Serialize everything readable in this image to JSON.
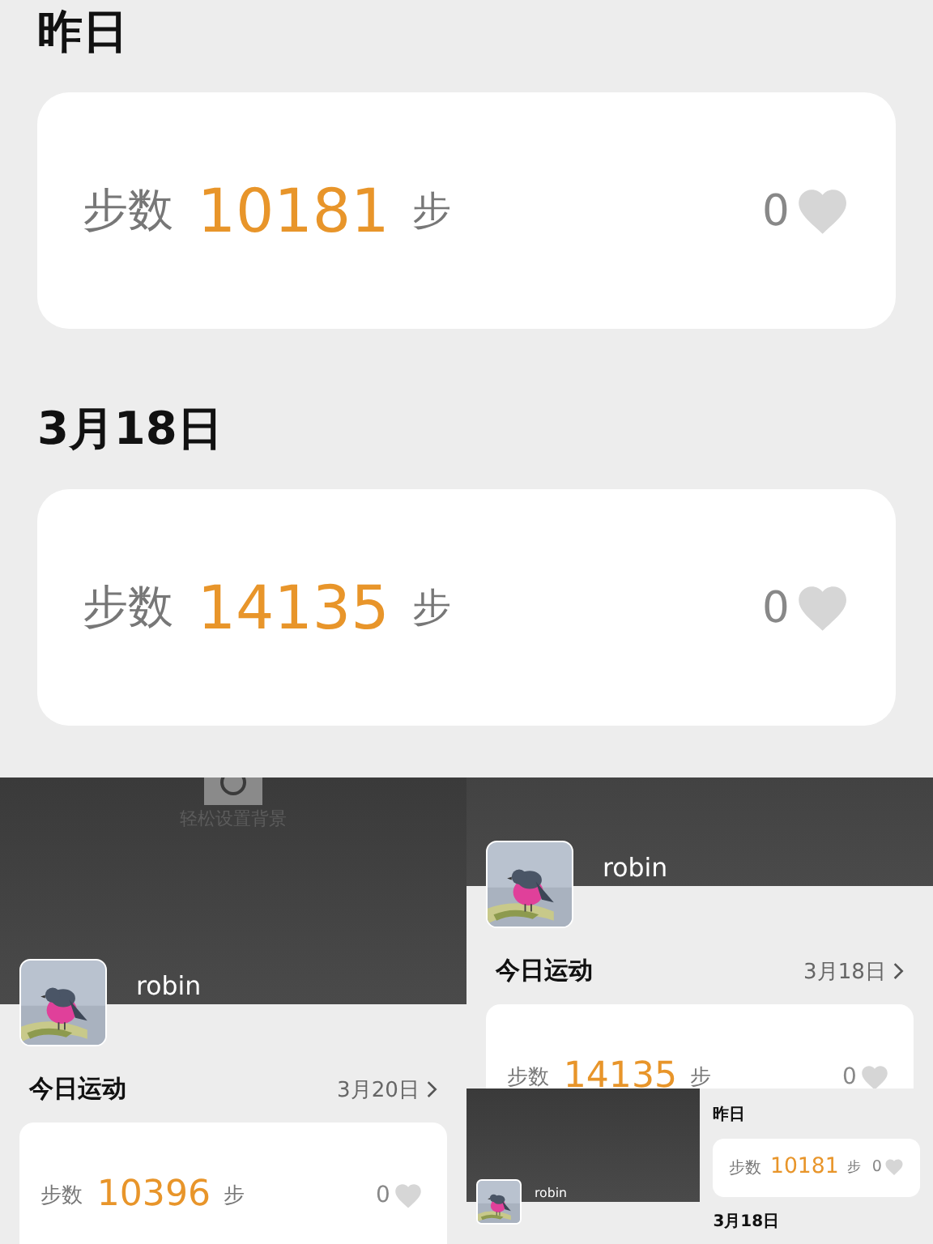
{
  "screens": [
    {
      "kind": "history",
      "sections": [
        {
          "title": "昨日",
          "card": {
            "label": "步数",
            "count": "10181",
            "unit": "步",
            "likes": "0"
          }
        },
        {
          "title": "3月18日",
          "card": {
            "label": "步数",
            "count": "14135",
            "unit": "步",
            "likes": "0"
          }
        }
      ]
    },
    {
      "kind": "profile",
      "background_hint": "轻松设置背景",
      "name": "robin",
      "today": {
        "title": "今日运动",
        "date": "3月20日",
        "card": {
          "label": "步数",
          "count": "10396",
          "unit": "步",
          "likes": "0"
        }
      }
    },
    {
      "kind": "profile",
      "name": "robin",
      "today": {
        "title": "今日运动",
        "date": "3月18日",
        "card": {
          "label": "步数",
          "count": "14135",
          "unit": "步",
          "likes": "0"
        }
      }
    },
    {
      "kind": "profile",
      "name": "robin"
    },
    {
      "kind": "history",
      "sections": [
        {
          "title": "昨日",
          "card": {
            "label": "步数",
            "count": "10181",
            "unit": "步",
            "likes": "0"
          }
        },
        {
          "title": "3月18日"
        }
      ]
    }
  ]
}
